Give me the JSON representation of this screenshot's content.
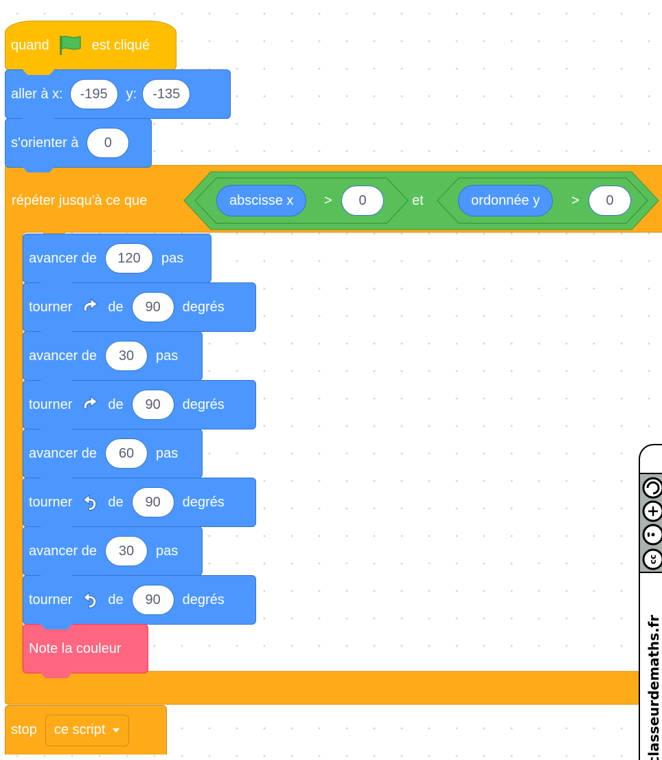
{
  "script": {
    "hat": {
      "prefix": "quand",
      "suffix": "est cliqué",
      "icon": "green-flag-icon"
    },
    "goto": {
      "label_x": "aller à x:",
      "x": "-195",
      "label_y": "y:",
      "y": "-135"
    },
    "orient": {
      "label": "s'orienter à",
      "value": "0"
    },
    "repeat": {
      "label": "répéter jusqu'à ce que",
      "and_label": "et",
      "cond1": {
        "reporter": "abscisse x",
        "op": ">",
        "value": "0"
      },
      "cond2": {
        "reporter": "ordonnée y",
        "op": ">",
        "value": "0"
      }
    },
    "body": [
      {
        "type": "move",
        "label": "avancer de",
        "value": "120",
        "unit": "pas"
      },
      {
        "type": "turn",
        "label": "tourner",
        "icon": "rotate-clockwise-icon",
        "de": "de",
        "value": "90",
        "unit": "degrés"
      },
      {
        "type": "move",
        "label": "avancer de",
        "value": "30",
        "unit": "pas"
      },
      {
        "type": "turn",
        "label": "tourner",
        "icon": "rotate-clockwise-icon",
        "de": "de",
        "value": "90",
        "unit": "degrés"
      },
      {
        "type": "move",
        "label": "avancer de",
        "value": "60",
        "unit": "pas"
      },
      {
        "type": "turn",
        "label": "tourner",
        "icon": "rotate-counterclockwise-icon",
        "de": "de",
        "value": "90",
        "unit": "degrés"
      },
      {
        "type": "move",
        "label": "avancer de",
        "value": "30",
        "unit": "pas"
      },
      {
        "type": "turn",
        "label": "tourner",
        "icon": "rotate-counterclockwise-icon",
        "de": "de",
        "value": "90",
        "unit": "degrés"
      }
    ],
    "custom": {
      "label": "Note la couleur"
    },
    "stop": {
      "label": "stop",
      "option": "ce script"
    }
  },
  "license": {
    "site": "monclasseurdemaths.fr",
    "badge": "cc-by-nc-sa-badge"
  },
  "colors": {
    "motion": "#4c97ff",
    "events": "#ffbf00",
    "control": "#ffab19",
    "operators": "#59c059",
    "custom": "#ff6680"
  }
}
